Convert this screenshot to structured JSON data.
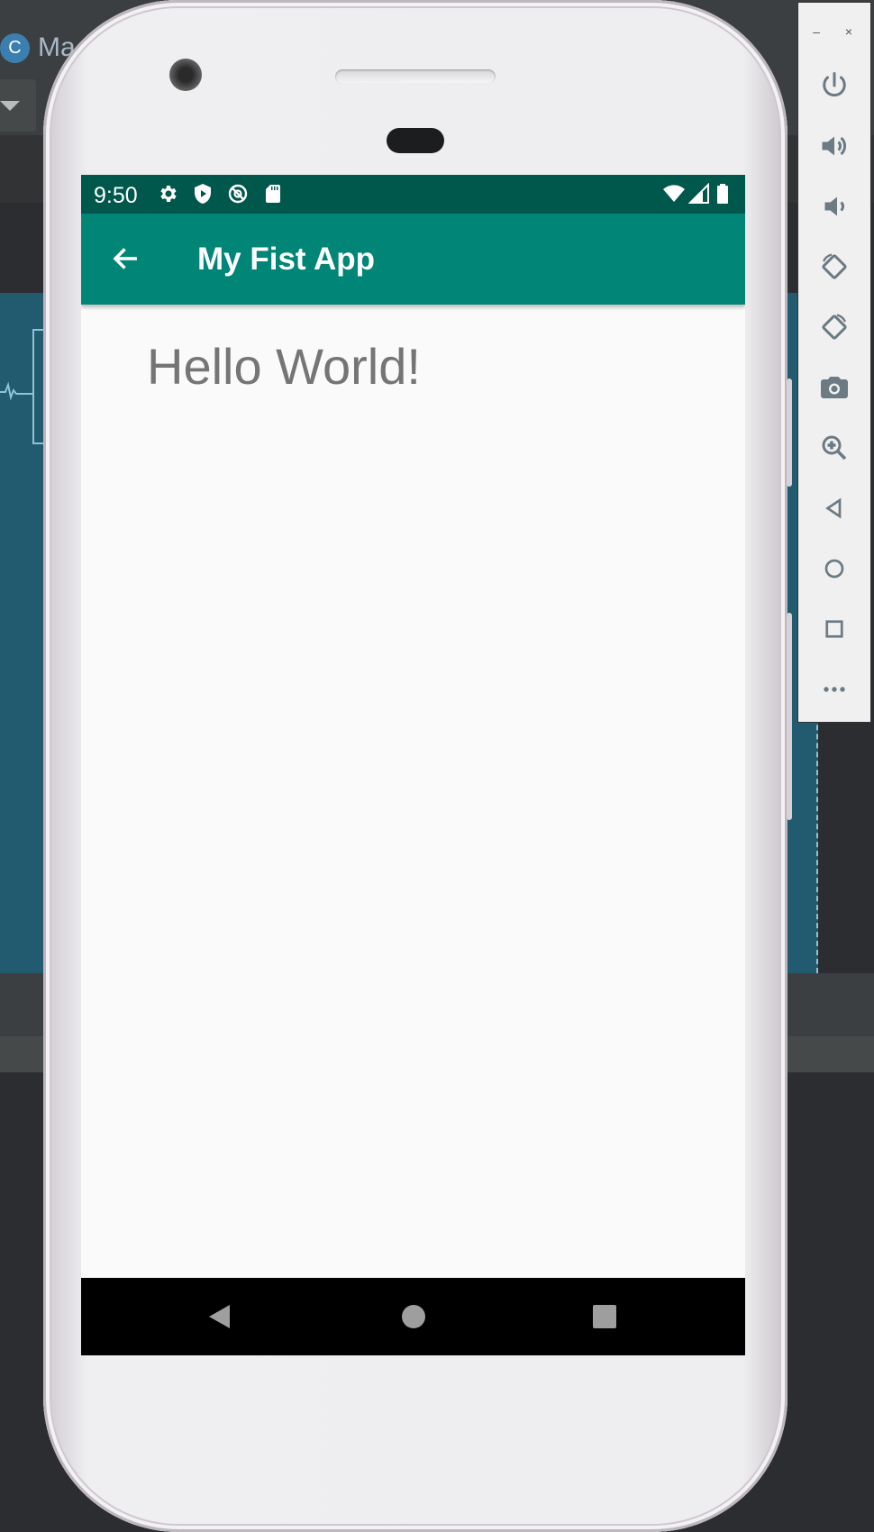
{
  "ide": {
    "logo_letter": "C",
    "title": "Ma"
  },
  "device": {
    "status_bar": {
      "time": "9:50",
      "left_icons": [
        "settings-icon",
        "shield-play-icon",
        "no-data-icon",
        "sd-card-icon"
      ],
      "right_icons": [
        "wifi-icon",
        "signal-icon",
        "battery-icon"
      ]
    },
    "app_bar": {
      "title": "My Fist App",
      "nav_icon": "back-arrow-icon"
    },
    "content": {
      "text": "Hello World!"
    },
    "nav_bar": [
      "back-triangle-icon",
      "home-circle-icon",
      "recents-square-icon"
    ]
  },
  "emulator_toolbar": {
    "window_controls": [
      "minimize-icon",
      "close-icon"
    ],
    "buttons": [
      "power-icon",
      "volume-up-icon",
      "volume-down-icon",
      "rotate-left-icon",
      "rotate-right-icon",
      "camera-icon",
      "zoom-icon",
      "back-icon",
      "home-icon",
      "overview-icon",
      "more-icon"
    ]
  },
  "colors": {
    "status_bar": "#00574b",
    "app_bar": "#008577",
    "screen_bg": "#fafafa",
    "hello_text": "#757575"
  }
}
